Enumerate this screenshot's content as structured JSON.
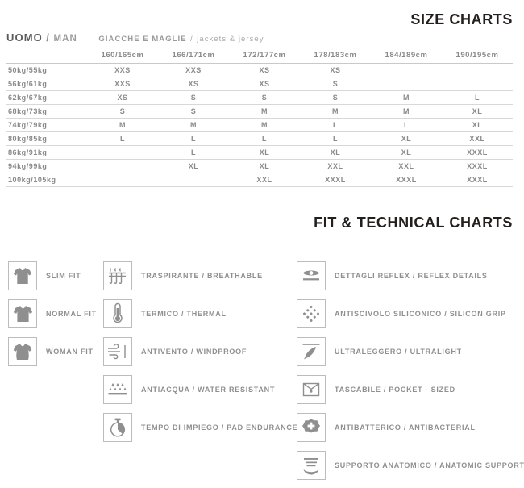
{
  "headings": {
    "size_charts": "SIZE CHARTS",
    "fit_charts": "FIT & TECHNICAL CHARTS"
  },
  "category": {
    "main": "UOMO",
    "separator": "/",
    "alt": "MAN",
    "sub": "GIACCHE E MAGLIE",
    "sub_separator": "/",
    "sub_alt": "jackets & jersey"
  },
  "size_table": {
    "corner": "",
    "columns": [
      "160/165cm",
      "166/171cm",
      "172/177cm",
      "178/183cm",
      "184/189cm",
      "190/195cm"
    ],
    "rows": [
      {
        "weight": "50kg/55kg",
        "sizes": [
          "XXS",
          "XXS",
          "XS",
          "XS",
          "",
          ""
        ]
      },
      {
        "weight": "56kg/61kg",
        "sizes": [
          "XXS",
          "XS",
          "XS",
          "S",
          "",
          ""
        ]
      },
      {
        "weight": "62kg/67kg",
        "sizes": [
          "XS",
          "S",
          "S",
          "S",
          "M",
          "L"
        ]
      },
      {
        "weight": "68kg/73kg",
        "sizes": [
          "S",
          "S",
          "M",
          "M",
          "M",
          "XL"
        ]
      },
      {
        "weight": "74kg/79kg",
        "sizes": [
          "M",
          "M",
          "M",
          "L",
          "L",
          "XL"
        ]
      },
      {
        "weight": "80kg/85kg",
        "sizes": [
          "L",
          "L",
          "L",
          "L",
          "XL",
          "XXL"
        ]
      },
      {
        "weight": "86kg/91kg",
        "sizes": [
          "",
          "L",
          "XL",
          "XL",
          "XL",
          "XXXL"
        ]
      },
      {
        "weight": "94kg/99kg",
        "sizes": [
          "",
          "XL",
          "XL",
          "XXL",
          "XXL",
          "XXXL"
        ]
      },
      {
        "weight": "100kg/105kg",
        "sizes": [
          "",
          "",
          "XXL",
          "XXXL",
          "XXXL",
          "XXXL"
        ]
      }
    ]
  },
  "legend": {
    "fit_column": [
      {
        "icon": "shirt-slim-icon",
        "label": "SLIM FIT"
      },
      {
        "icon": "shirt-normal-icon",
        "label": "NORMAL FIT"
      },
      {
        "icon": "shirt-woman-icon",
        "label": "WOMAN FIT"
      }
    ],
    "tech_column": [
      {
        "icon": "breathable-icon",
        "label": "TRASPIRANTE / BREATHABLE"
      },
      {
        "icon": "thermometer-icon",
        "label": "TERMICO / THERMAL"
      },
      {
        "icon": "windproof-icon",
        "label": "ANTIVENTO / WINDPROOF"
      },
      {
        "icon": "water-resistant-icon",
        "label": "ANTIACQUA / WATER RESISTANT"
      },
      {
        "icon": "stopwatch-icon",
        "label": "TEMPO DI IMPIEGO / PAD ENDURANCE"
      }
    ],
    "features_column": [
      {
        "icon": "reflex-eye-icon",
        "label": "DETTAGLI REFLEX / REFLEX DETAILS"
      },
      {
        "icon": "silicon-grip-icon",
        "label": "ANTISCIVOLO SILICONICO / SILICON GRIP"
      },
      {
        "icon": "feather-icon",
        "label": "ULTRALEGGERO / ULTRALIGHT"
      },
      {
        "icon": "pocket-icon",
        "label": "TASCABILE / POCKET - SIZED"
      },
      {
        "icon": "antibacterial-icon",
        "label": "ANTIBATTERICO / ANTIBACTERIAL"
      },
      {
        "icon": "anatomic-support-icon",
        "label": "SUPPORTO ANATOMICO / ANATOMIC SUPPORT"
      }
    ]
  },
  "colors": {
    "heading": "#231f1c",
    "text": "#8a8a8a",
    "rule": "#d8d8d8",
    "icon": "#8f8f8f",
    "box_border": "#bcbcbc"
  }
}
